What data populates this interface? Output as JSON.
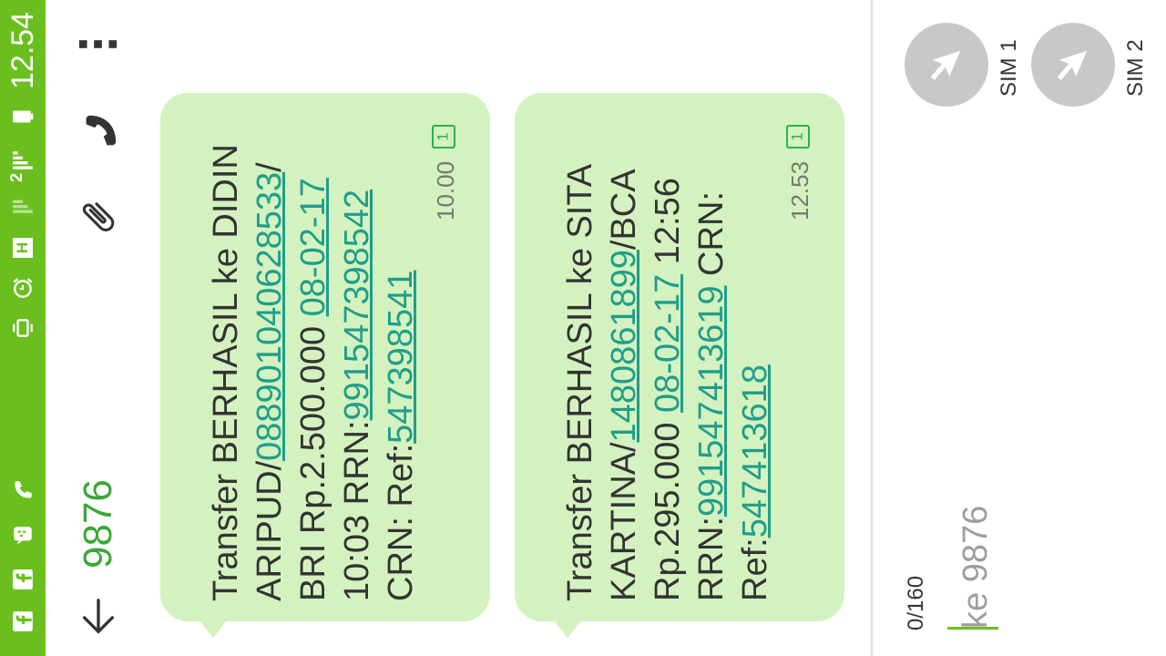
{
  "status_bar": {
    "time": "12.54",
    "sim2_indicator": "2",
    "network_label": "H",
    "icons": [
      "battery-icon",
      "signal-icon",
      "network-h-icon",
      "alarm-icon",
      "vibrate-icon",
      "phone-icon",
      "bbm-icon",
      "facebook-icon",
      "facebook-icon"
    ]
  },
  "header": {
    "contact": "9876",
    "icons": [
      "back-arrow-icon",
      "overflow-menu-icon",
      "call-icon",
      "attachment-icon"
    ]
  },
  "messages": [
    {
      "parts": [
        {
          "text": "Transfer BERHASIL ke DIDIN ARIPUD/",
          "link": false
        },
        {
          "text": "088901040628533",
          "link": true
        },
        {
          "text": "/ BRI Rp.2.500.000 ",
          "link": false
        },
        {
          "text": "08-02-17",
          "link": true
        },
        {
          "text": " 10:03 RRN:",
          "link": false
        },
        {
          "text": "991547398542",
          "link": true
        },
        {
          "text": " CRN:  Ref:",
          "link": false
        },
        {
          "text": "547398541",
          "link": true
        }
      ],
      "time": "10.00",
      "sim": "1"
    },
    {
      "parts": [
        {
          "text": "Transfer BERHASIL ke SITA KARTINA/",
          "link": false
        },
        {
          "text": "1480861899",
          "link": true
        },
        {
          "text": "/BCA Rp.295.000 ",
          "link": false
        },
        {
          "text": "08-02-17",
          "link": true
        },
        {
          "text": " 12:56 RRN:",
          "link": false
        },
        {
          "text": "991547413619",
          "link": true
        },
        {
          "text": " CRN: Ref:",
          "link": false
        },
        {
          "text": "547413618",
          "link": true
        }
      ],
      "time": "12.53",
      "sim": "1"
    }
  ],
  "compose": {
    "char_count": "0/160",
    "placeholder": "ke 9876",
    "send_buttons": [
      {
        "label": "SIM 1",
        "icon": "send-icon"
      },
      {
        "label": "SIM 2",
        "icon": "send-icon"
      }
    ]
  },
  "colors": {
    "status_bar": "#6abf1e",
    "bubble": "#d4f2bf",
    "link": "#1f9e8a",
    "contact": "#3aa835",
    "sim_badge": "#2bb24c",
    "send_button": "#c8c8c8"
  }
}
